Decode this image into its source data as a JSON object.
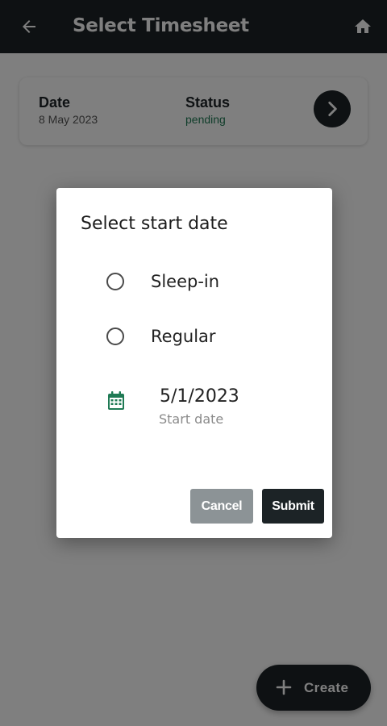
{
  "appbar": {
    "title": "Select Timesheet",
    "back_icon": "arrow-left-icon",
    "home_icon": "home-icon"
  },
  "card": {
    "date_label": "Date",
    "date_value": "8 May 2023",
    "status_label": "Status",
    "status_value": "pending",
    "status_color": "#1f7a54",
    "open_icon": "chevron-right-icon"
  },
  "fab": {
    "label": "Create",
    "icon": "plus-icon"
  },
  "dialog": {
    "title": "Select start date",
    "options": [
      {
        "label": "Sleep-in",
        "selected": false
      },
      {
        "label": "Regular",
        "selected": false
      }
    ],
    "date": {
      "icon": "calendar-icon",
      "value": "5/1/2023",
      "hint": "Start date",
      "icon_color": "#1f7a54"
    },
    "cancel_label": "Cancel",
    "submit_label": "Submit"
  },
  "colors": {
    "primary_dark": "#1c2326",
    "accent_green": "#1f7a54",
    "cancel_gray": "#8c9396"
  }
}
